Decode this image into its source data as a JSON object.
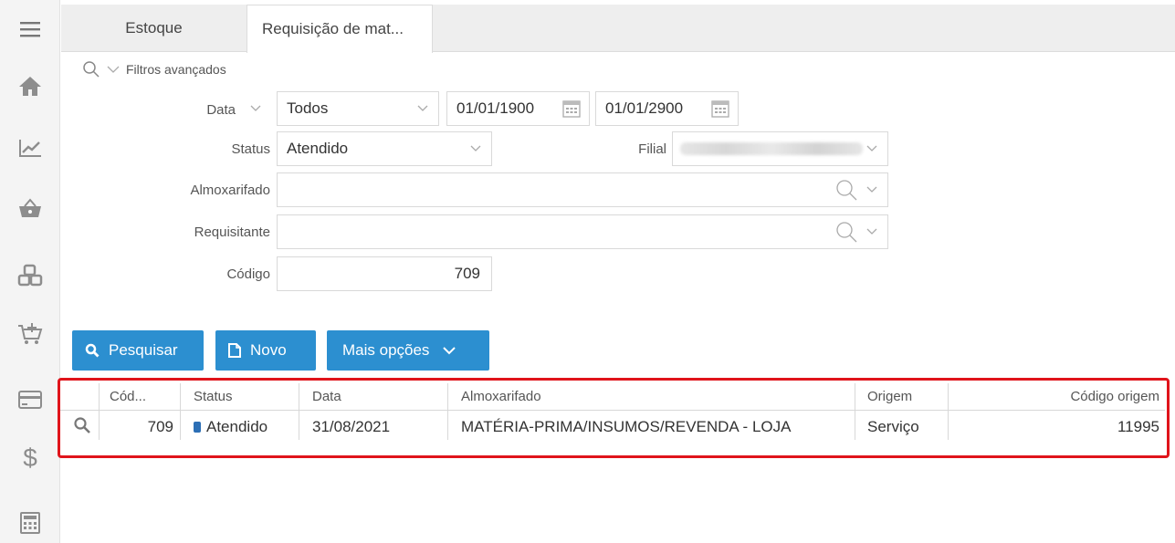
{
  "tabs": [
    {
      "label": "Estoque"
    },
    {
      "label": "Requisição de mat..."
    }
  ],
  "filters": {
    "advanced_label": "Filtros avançados",
    "data_label": "Data",
    "data_select": "Todos",
    "date_from": "01/01/1900",
    "date_to": "01/01/2900",
    "status_label": "Status",
    "status_value": "Atendido",
    "filial_label": "Filial",
    "almox_label": "Almoxarifado",
    "almox_value": "",
    "requisitante_label": "Requisitante",
    "requisitante_value": "",
    "codigo_label": "Código",
    "codigo_value": "709"
  },
  "buttons": {
    "pesquisar": "Pesquisar",
    "novo": "Novo",
    "mais_opcoes": "Mais opções"
  },
  "table": {
    "headers": {
      "cod": "Cód...",
      "status": "Status",
      "data": "Data",
      "almox": "Almoxarifado",
      "origem": "Origem",
      "codigo_origem": "Código origem"
    },
    "rows": [
      {
        "cod": "709",
        "status": "Atendido",
        "data": "31/08/2021",
        "almox": "MATÉRIA-PRIMA/INSUMOS/REVENDA - LOJA",
        "origem": "Serviço",
        "codigo_origem": "11995"
      }
    ]
  },
  "colors": {
    "accent": "#2c8fd0",
    "highlight_border": "#e0141b",
    "status_atendido": "#2c6fb5"
  }
}
